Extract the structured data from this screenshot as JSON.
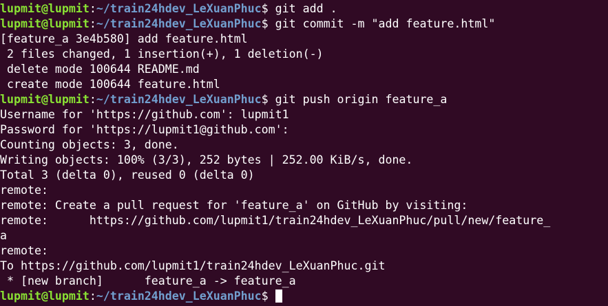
{
  "prompt": {
    "user": "lupmit@lupmit",
    "colon": ":",
    "path": "~/train24hdev_LeXuanPhuc",
    "dollar": "$"
  },
  "lines": [
    {
      "type": "prompt",
      "cmd": " git add ."
    },
    {
      "type": "prompt",
      "cmd": " git commit -m \"add feature.html\""
    },
    {
      "type": "output",
      "text": "[feature_a 3e4b580] add feature.html"
    },
    {
      "type": "output",
      "text": " 2 files changed, 1 insertion(+), 1 deletion(-)"
    },
    {
      "type": "output",
      "text": " delete mode 100644 README.md"
    },
    {
      "type": "output",
      "text": " create mode 100644 feature.html"
    },
    {
      "type": "prompt",
      "cmd": " git push origin feature_a"
    },
    {
      "type": "output",
      "text": "Username for 'https://github.com': lupmit1"
    },
    {
      "type": "output",
      "text": "Password for 'https://lupmit1@github.com':"
    },
    {
      "type": "output",
      "text": "Counting objects: 3, done."
    },
    {
      "type": "output",
      "text": "Writing objects: 100% (3/3), 252 bytes | 252.00 KiB/s, done."
    },
    {
      "type": "output",
      "text": "Total 3 (delta 0), reused 0 (delta 0)"
    },
    {
      "type": "output",
      "text": "remote:"
    },
    {
      "type": "output",
      "text": "remote: Create a pull request for 'feature_a' on GitHub by visiting:"
    },
    {
      "type": "output",
      "text": "remote:      https://github.com/lupmit1/train24hdev_LeXuanPhuc/pull/new/feature_"
    },
    {
      "type": "output",
      "text": "a"
    },
    {
      "type": "output",
      "text": "remote:"
    },
    {
      "type": "output",
      "text": "To https://github.com/lupmit1/train24hdev_LeXuanPhuc.git"
    },
    {
      "type": "output",
      "text": " * [new branch]      feature_a -> feature_a"
    },
    {
      "type": "prompt",
      "cmd": " ",
      "cursor": true
    }
  ],
  "colors": {
    "background": "#300a24",
    "user": "#8ae234",
    "path": "#729fcf",
    "text": "#ffffff"
  }
}
